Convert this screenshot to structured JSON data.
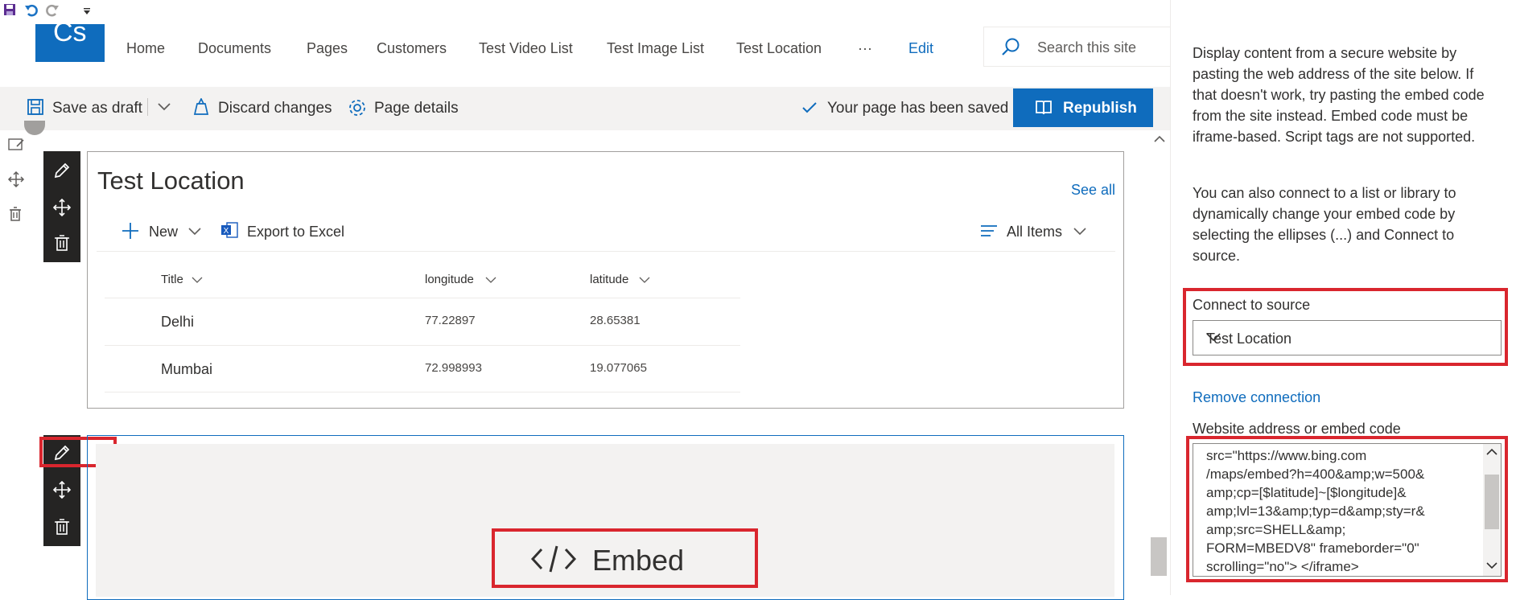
{
  "suite_nav": {
    "logo_text": "Cs",
    "links": [
      "Home",
      "Documents",
      "Pages",
      "Customers",
      "Test Video List",
      "Test Image List",
      "Test Location"
    ],
    "more_label": "···",
    "edit_label": "Edit",
    "search_placeholder": "Search this site"
  },
  "command_bar": {
    "save_draft": "Save as draft",
    "discard": "Discard changes",
    "page_details": "Page details",
    "saved_status": "Your page has been saved",
    "republish": "Republish"
  },
  "list_webpart": {
    "title": "Test Location",
    "see_all": "See all",
    "new_label": "New",
    "export_label": "Export to Excel",
    "view_label": "All Items",
    "columns": [
      "Title",
      "longitude",
      "latitude"
    ],
    "rows": [
      {
        "title": "Delhi",
        "longitude": "77.22897",
        "latitude": "28.65381"
      },
      {
        "title": "Mumbai",
        "longitude": "72.998993",
        "latitude": "19.077065"
      }
    ]
  },
  "embed_webpart": {
    "label": "Embed"
  },
  "property_pane": {
    "description_1": "Display content from a secure website by pasting the web address of the site below. If that doesn't work, try pasting the embed code from the site instead. Embed code must be iframe-based. Script tags are not supported.",
    "description_2": "You can also connect to a list or library to dynamically change your embed code by selecting the ellipses (...) and Connect to source.",
    "connect_label": "Connect to source",
    "connect_value": "Test Location",
    "remove_connection": "Remove connection",
    "website_label": "Website address or embed code",
    "embed_code": "src=\"https://www.bing.com\n/maps/embed?h=400&amp;w=500&\namp;cp=[$latitude]~[$longitude]&\namp;lvl=13&amp;typ=d&amp;sty=r&\namp;src=SHELL&amp;\nFORM=MBEDV8\" frameborder=\"0\"\nscrolling=\"no\"> </iframe>"
  },
  "colors": {
    "accent": "#0f6cbd",
    "highlight": "#d9262e",
    "toolbar": "#252423"
  }
}
